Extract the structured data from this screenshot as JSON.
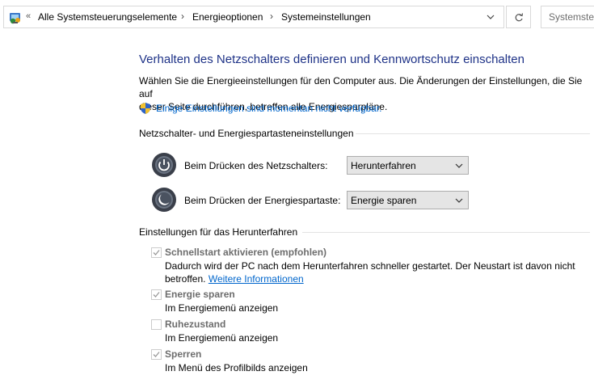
{
  "address_bar": {
    "back_chevron": "«",
    "breadcrumbs": [
      "Alle Systemsteuerungselemente",
      "Energieoptionen",
      "Systemeinstellungen"
    ],
    "separator": "›",
    "search_placeholder": "Systemsteuerung durchsuchen"
  },
  "page": {
    "title": "Verhalten des Netzschalters definieren und Kennwortschutz einschalten",
    "description_line1": "Wählen Sie die Energieeinstellungen für den Computer aus. Die Änderungen der Einstellungen, die Sie auf",
    "description_line2": "dieser Seite durchführen, betreffen alle Energiesparpläne.",
    "admin_link": "Einige Einstellungen sind momentan nicht verfügbar."
  },
  "power_section": {
    "heading": "Netzschalter- und Energiespartasteneinstellungen",
    "power_button_label": "Beim Drücken des Netzschalters:",
    "power_button_value": "Herunterfahren",
    "sleep_button_label": "Beim Drücken der Energiespartaste:",
    "sleep_button_value": "Energie sparen"
  },
  "shutdown_section": {
    "heading": "Einstellungen für das Herunterfahren",
    "items": [
      {
        "title": "Schnellstart aktivieren (empfohlen)",
        "checked": true,
        "desc_line1": "Dadurch wird der PC nach dem Herunterfahren schneller gestartet. Der Neustart ist davon nicht",
        "desc_line2": "betroffen.",
        "link": "Weitere Informationen"
      },
      {
        "title": "Energie sparen",
        "checked": true,
        "desc": "Im Energiemenü anzeigen"
      },
      {
        "title": "Ruhezustand",
        "checked": false,
        "desc": "Im Energiemenü anzeigen"
      },
      {
        "title": "Sperren",
        "checked": true,
        "desc": "Im Menü des Profilbilds anzeigen"
      }
    ]
  },
  "colors": {
    "title": "#1e3287",
    "link": "#0066cc",
    "disabled_text": "#6d6d6d"
  }
}
